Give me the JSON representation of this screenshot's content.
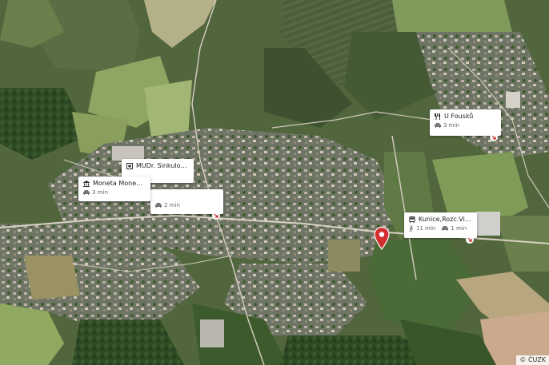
{
  "map": {
    "copyright": "© ČUZK",
    "selected_marker_color": "#d32f2f"
  },
  "pois": [
    {
      "name": "U Fousků",
      "icon": "fork-knife-icon",
      "car_time": "3 min"
    },
    {
      "name": "MUDr. Sinkulová ...",
      "icon": "medical-cross-icon",
      "car_time": ""
    },
    {
      "name": "Moneta Money B...",
      "icon": "bank-icon",
      "car_time": "3 min"
    },
    {
      "name": "",
      "icon": "",
      "car_time": "2 min"
    },
    {
      "name": "Kunice,Rozc.Vidov...",
      "icon": "bus-icon",
      "walk_time": "11 min",
      "car_time": "1 min"
    }
  ]
}
